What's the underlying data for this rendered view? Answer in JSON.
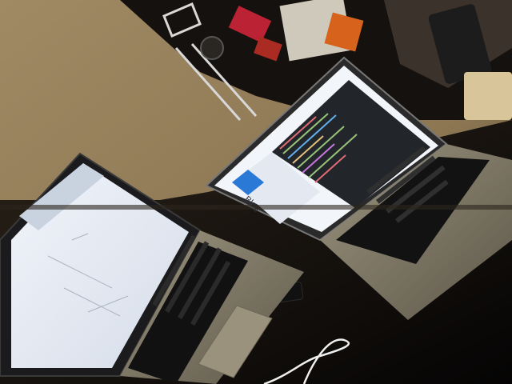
{
  "scene": {
    "description_hidden": "",
    "colors": {
      "wall": "#9a845f",
      "wall_dark": "#5a4a34",
      "desk": "#1a1513",
      "desk_dark": "#070505",
      "aluminium": "#8e8774",
      "aluminium_dark": "#5f5a4c",
      "keyboard": "#141414",
      "screen_white": "#e9eef6",
      "editor_bg": "#23262b",
      "window_blue": "#2b79d6",
      "cable_white": "#efefef",
      "phone": "#101010"
    }
  },
  "back_laptop": {
    "screen_text": {
      "blog_label": "Blog"
    }
  }
}
